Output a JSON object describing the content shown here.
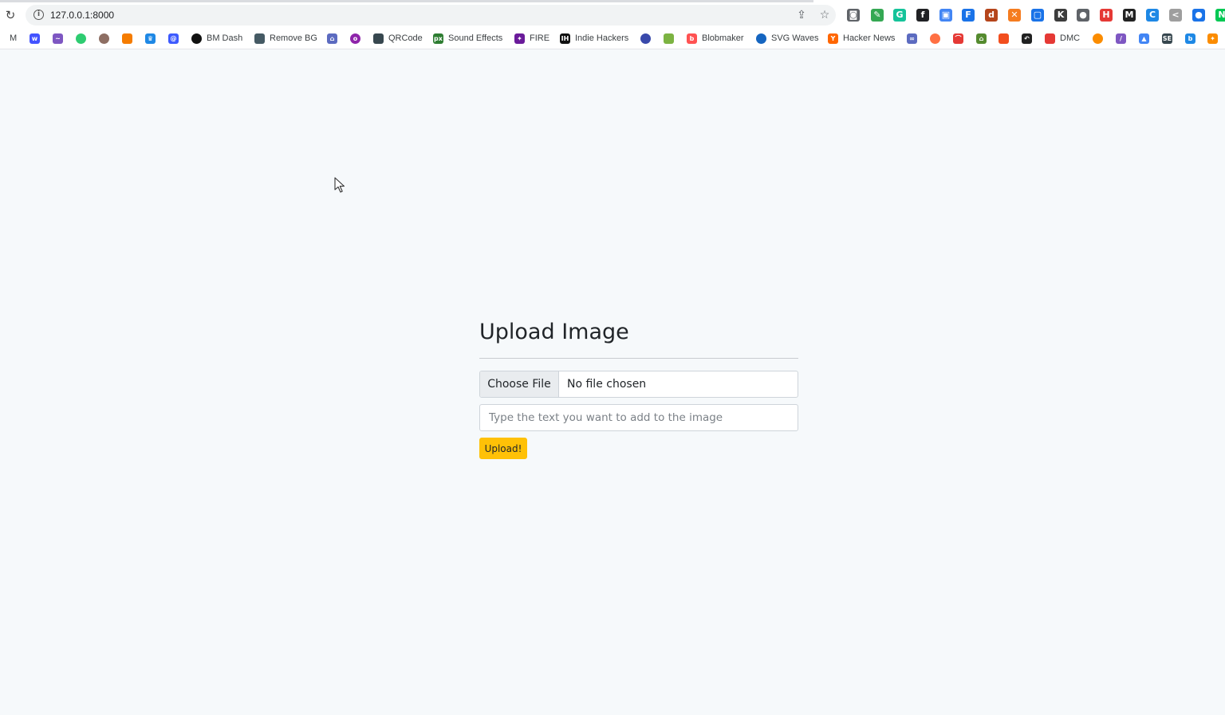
{
  "browser": {
    "url": "127.0.0.1:8000",
    "omnibox_icons": [
      "info-icon",
      "share-icon",
      "star-icon"
    ],
    "extensions": [
      {
        "icon": "camera-icon",
        "color": "#5f6368",
        "glyph": "◙"
      },
      {
        "icon": "eyedropper-icon",
        "color": "#34a853",
        "glyph": "✎"
      },
      {
        "icon": "grammarly-icon",
        "color": "#15c39a",
        "glyph": "G"
      },
      {
        "icon": "font-icon",
        "color": "#202124",
        "glyph": "f"
      },
      {
        "icon": "window-icon",
        "color": "#4285f4",
        "glyph": "▣"
      },
      {
        "icon": "file-icon",
        "color": "#1a73e8",
        "glyph": "F"
      },
      {
        "icon": "desc-icon",
        "color": "#b5451b",
        "glyph": "d"
      },
      {
        "icon": "close-circle-icon",
        "color": "#f57c20",
        "glyph": "✕"
      },
      {
        "icon": "screen-icon",
        "color": "#1a73e8",
        "glyph": "▢"
      },
      {
        "icon": "k-icon",
        "color": "#3c3c3c",
        "glyph": "K"
      },
      {
        "icon": "cup-icon",
        "color": "#5f6368",
        "glyph": "●"
      },
      {
        "icon": "hi-icon",
        "color": "#e53935",
        "glyph": "H"
      },
      {
        "icon": "m-icon",
        "color": "#222222",
        "glyph": "M"
      },
      {
        "icon": "c-icon",
        "color": "#1e88e5",
        "glyph": "C"
      },
      {
        "icon": "code-icon",
        "color": "#9e9e9e",
        "glyph": "<"
      },
      {
        "icon": "record-icon",
        "color": "#1a73e8",
        "glyph": "●"
      },
      {
        "icon": "n-icon",
        "color": "#00c853",
        "glyph": "N"
      }
    ],
    "bookmarks": [
      {
        "icon": "m-icon",
        "label": "M",
        "color": "#ffffff",
        "glyph": ""
      },
      {
        "icon": "webflow-icon",
        "label": "",
        "color": "#4353ff",
        "glyph": "w"
      },
      {
        "icon": "fish-icon",
        "label": "",
        "color": "#7e57c2",
        "glyph": "~"
      },
      {
        "icon": "dot-icon",
        "label": "",
        "color": "#2ecc71",
        "glyph": ""
      },
      {
        "icon": "avatar-icon",
        "label": "",
        "color": "#8d6e63",
        "glyph": ""
      },
      {
        "icon": "cube-icon",
        "label": "",
        "color": "#f57c00",
        "glyph": ""
      },
      {
        "icon": "crown-icon",
        "label": "",
        "color": "#1e88e5",
        "glyph": "♛"
      },
      {
        "icon": "at-icon",
        "label": "",
        "color": "#3d5afe",
        "glyph": "@"
      },
      {
        "icon": "bm-dash-icon",
        "label": "BM Dash",
        "color": "#111111",
        "glyph": ""
      },
      {
        "icon": "remove-bg-icon",
        "label": "Remove BG",
        "color": "#455a64",
        "glyph": ""
      },
      {
        "icon": "car-icon",
        "label": "",
        "color": "#5c6bc0",
        "glyph": "⌂"
      },
      {
        "icon": "o-icon",
        "label": "",
        "color": "#8e24aa",
        "glyph": "o"
      },
      {
        "icon": "qrcode-icon",
        "label": "QRCode",
        "color": "#37474f",
        "glyph": ""
      },
      {
        "icon": "sound-effects-icon",
        "label": "Sound Effects",
        "color": "#2e7d32",
        "glyph": "px"
      },
      {
        "icon": "fire-icon",
        "label": "FIRE",
        "color": "#6a1b9a",
        "glyph": "✦"
      },
      {
        "icon": "indie-hackers-icon",
        "label": "Indie Hackers",
        "color": "#111111",
        "glyph": "IH"
      },
      {
        "icon": "shield-icon",
        "label": "",
        "color": "#3949ab",
        "glyph": ""
      },
      {
        "icon": "grid-icon",
        "label": "",
        "color": "#7cb342",
        "glyph": ""
      },
      {
        "icon": "blobmaker-icon",
        "label": "Blobmaker",
        "color": "#ff5252",
        "glyph": "b"
      },
      {
        "icon": "svg-waves-icon",
        "label": "SVG Waves",
        "color": "#1565c0",
        "glyph": ""
      },
      {
        "icon": "hacker-news-icon",
        "label": "Hacker News",
        "color": "#ff6600",
        "glyph": "Y"
      },
      {
        "icon": "link-icon",
        "label": "",
        "color": "#5c6bc0",
        "glyph": "∞"
      },
      {
        "icon": "firefox-icon",
        "label": "",
        "color": "#ff7043",
        "glyph": ""
      },
      {
        "icon": "gauge-icon",
        "label": "",
        "color": "#e53935",
        "glyph": "⌒"
      },
      {
        "icon": "house-icon",
        "label": "",
        "color": "#558b2f",
        "glyph": "⌂"
      },
      {
        "icon": "figma-icon",
        "label": "",
        "color": "#f24e1e",
        "glyph": ""
      },
      {
        "icon": "hook-icon",
        "label": "",
        "color": "#212121",
        "glyph": "↶"
      },
      {
        "icon": "dmc-icon",
        "label": "DMC",
        "color": "#e53935",
        "glyph": ""
      },
      {
        "icon": "palette-icon",
        "label": "",
        "color": "#fb8c00",
        "glyph": ""
      },
      {
        "icon": "brush-icon",
        "label": "",
        "color": "#7e57c2",
        "glyph": "/"
      },
      {
        "icon": "ads-icon",
        "label": "",
        "color": "#4285f4",
        "glyph": "▲"
      },
      {
        "icon": "se-icon",
        "label": "",
        "color": "#37474f",
        "glyph": "SE"
      },
      {
        "icon": "bing-icon",
        "label": "",
        "color": "#1e88e5",
        "glyph": "b"
      },
      {
        "icon": "puzzle-icon",
        "label": "",
        "color": "#fb8c00",
        "glyph": "✦"
      }
    ]
  },
  "page": {
    "title": "Upload Image",
    "file_button_label": "Choose File",
    "file_status": "No file chosen",
    "text_placeholder": "Type the text you want to add to the image",
    "text_value": "",
    "submit_label": "Upload!",
    "accent_color": "#ffc107"
  }
}
